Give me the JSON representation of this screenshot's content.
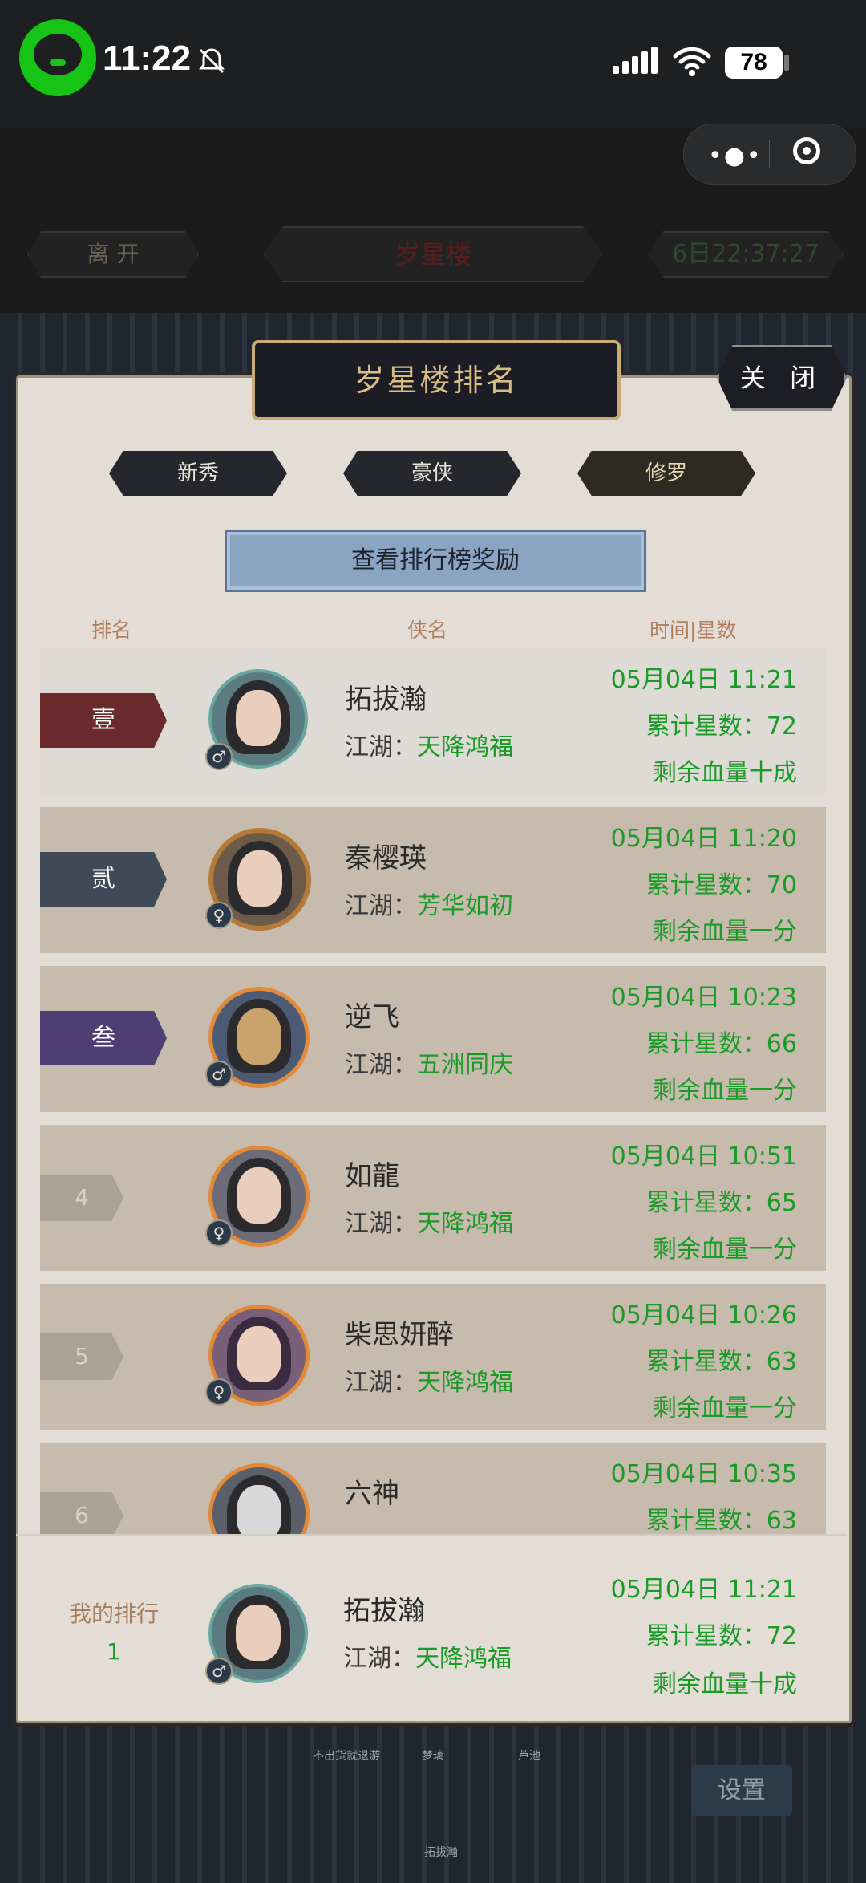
{
  "status_bar": {
    "time": "11:22",
    "battery": "78",
    "icons": [
      "wechat-icon",
      "bell-muted-icon",
      "signal-icon",
      "wifi-icon",
      "battery-icon"
    ]
  },
  "top_bar": {
    "leave": "离 开",
    "location": "岁星楼",
    "timer": "6日22:37:27"
  },
  "panel": {
    "title": "岁星楼排名",
    "close": "关 闭",
    "tabs": [
      "新秀",
      "豪侠",
      "修罗"
    ],
    "selected_tab": "修罗",
    "reward_button": "查看排行榜奖励",
    "columns": {
      "rank": "排名",
      "name": "侠名",
      "time_stars": "时间|星数"
    }
  },
  "rows": [
    {
      "rank": "壹",
      "name": "拓拔瀚",
      "jianghu_label": "江湖：",
      "jianghu": "天降鸿福",
      "gender": "♂",
      "time": "05月04日 11:21",
      "stars": "累计星数：72",
      "hp": "剩余血量十成",
      "color": "#6b2a2b"
    },
    {
      "rank": "贰",
      "name": "秦樱瑛",
      "jianghu_label": "江湖：",
      "jianghu": "芳华如初",
      "gender": "♀",
      "time": "05月04日 11:20",
      "stars": "累计星数：70",
      "hp": "剩余血量一分",
      "color": "#404a57"
    },
    {
      "rank": "叁",
      "name": "逆飞",
      "jianghu_label": "江湖：",
      "jianghu": "五洲同庆",
      "gender": "♂",
      "time": "05月04日 10:23",
      "stars": "累计星数：66",
      "hp": "剩余血量一分",
      "color": "#4d3e73"
    },
    {
      "rank": "4",
      "name": "如龍",
      "jianghu_label": "江湖：",
      "jianghu": "天降鸿福",
      "gender": "♀",
      "time": "05月04日 10:51",
      "stars": "累计星数：65",
      "hp": "剩余血量一分"
    },
    {
      "rank": "5",
      "name": "柴思妍醉",
      "jianghu_label": "江湖：",
      "jianghu": "天降鸿福",
      "gender": "♀",
      "time": "05月04日 10:26",
      "stars": "累计星数：63",
      "hp": "剩余血量一分"
    },
    {
      "rank": "6",
      "name": "六神",
      "jianghu_label": "",
      "jianghu": "",
      "gender": "♂",
      "time": "05月04日 10:35",
      "stars": "累计星数：63",
      "hp": ""
    }
  ],
  "my_rank": {
    "label": "我的排行",
    "rank": "1",
    "name": "拓拔瀚",
    "jianghu_label": "江湖：",
    "jianghu": "天降鸿福",
    "gender": "♂",
    "time": "05月04日 11:21",
    "stars": "累计星数：72",
    "hp": "剩余血量十成"
  },
  "background": {
    "settings": "设置",
    "bottom_names": [
      "不出货就退游",
      "梦璃",
      "芦池",
      "拓拔瀚"
    ]
  }
}
